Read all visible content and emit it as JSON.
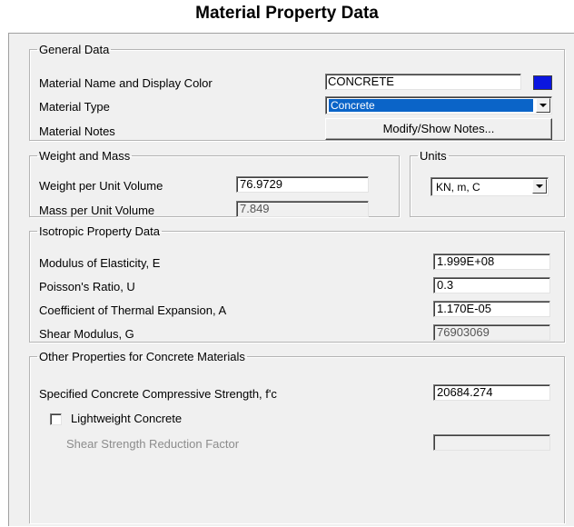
{
  "window": {
    "title": "Material Property Data"
  },
  "general": {
    "legend": "General Data",
    "name_label": "Material Name and Display Color",
    "name_value": "CONCRETE",
    "display_color": "#0b16e0",
    "type_label": "Material Type",
    "type_value": "Concrete",
    "notes_label": "Material Notes",
    "notes_button": "Modify/Show Notes..."
  },
  "weight": {
    "legend": "Weight and Mass",
    "weight_label": "Weight per Unit Volume",
    "weight_value": "76.9729",
    "mass_label": "Mass per Unit Volume",
    "mass_value": "7.849"
  },
  "units": {
    "legend": "Units",
    "value": "KN, m, C"
  },
  "isotropic": {
    "legend": "Isotropic Property Data",
    "modulus_label": "Modulus of Elasticity,  E",
    "modulus_value": "1.999E+08",
    "poisson_label": "Poisson's Ratio,  U",
    "poisson_value": "0.3",
    "thermal_label": "Coefficient of Thermal Expansion,  A",
    "thermal_value": "1.170E-05",
    "shear_label": "Shear Modulus,  G",
    "shear_value": "76903069"
  },
  "concrete": {
    "legend": "Other Properties for Concrete Materials",
    "fc_label": "Specified Concrete Compressive Strength, f'c",
    "fc_value": "20684.274",
    "lightweight_label": "Lightweight Concrete",
    "lightweight_checked": false,
    "reduction_label": "Shear Strength Reduction Factor",
    "reduction_value": ""
  }
}
